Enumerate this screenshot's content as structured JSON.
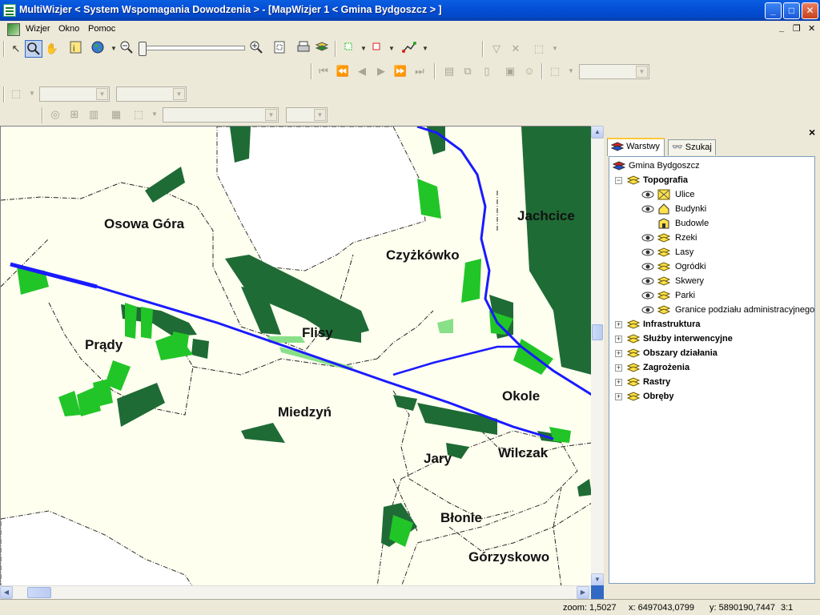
{
  "window": {
    "title": "MultiWizjer < System Wspomagania Dowodzenia > - [MapWizjer 1 < Gmina Bydgoszcz > ]",
    "controls": [
      "_",
      "□",
      "✕"
    ]
  },
  "menu": {
    "items": [
      "Wizjer",
      "Okno",
      "Pomoc"
    ],
    "mdi_controls": [
      "_",
      "❐",
      "✕"
    ]
  },
  "map": {
    "places": [
      {
        "name": "Osowa Góra"
      },
      {
        "name": "Czyżkówko"
      },
      {
        "name": "Jachcice"
      },
      {
        "name": "Prądy"
      },
      {
        "name": "Flisy"
      },
      {
        "name": "Okole"
      },
      {
        "name": "Miedzyń"
      },
      {
        "name": "Jary"
      },
      {
        "name": "Wilczak"
      },
      {
        "name": "Błonie"
      },
      {
        "name": "Górzyskowo"
      }
    ],
    "colors": {
      "background": "#fffff0",
      "forest": "#1f6b35",
      "green": "#22c528",
      "river": "#1a1aff",
      "boundary": "#333333"
    }
  },
  "panel": {
    "close": "×",
    "tabs": [
      "Warstwy",
      "Szukaj"
    ],
    "root": "Gmina Bydgoszcz",
    "groups": [
      {
        "label": "Topografia",
        "expanded": true,
        "expander": "−",
        "children": [
          "Ulice",
          "Budynki",
          "Budowle",
          "Rzeki",
          "Lasy",
          "Ogródki",
          "Skwery",
          "Parki",
          "Granice podziału administracyjnego"
        ]
      },
      {
        "label": "Infrastruktura",
        "expander": "+"
      },
      {
        "label": "Służby interwencyjne",
        "expander": "+"
      },
      {
        "label": "Obszary działania",
        "expander": "+"
      },
      {
        "label": "Zagrożenia",
        "expander": "+"
      },
      {
        "label": "Rastry",
        "expander": "+"
      },
      {
        "label": "Obręby",
        "expander": "+"
      }
    ]
  },
  "status": {
    "zoom": "zoom: 1,5027",
    "x": "x: 6497043,0799",
    "y": "y: 5890190,7447",
    "scale": "3:1"
  }
}
